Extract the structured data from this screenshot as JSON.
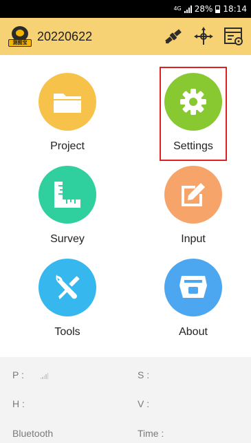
{
  "status_bar": {
    "network": "4G",
    "battery": "28%",
    "time": "18:14"
  },
  "app_bar": {
    "logo_text": "测图宝",
    "project_name": "20220622",
    "actions": [
      {
        "icon": "satellite-icon"
      },
      {
        "icon": "crosshair-icon"
      },
      {
        "icon": "window-settings-icon"
      }
    ]
  },
  "menu": {
    "items": [
      {
        "id": "project",
        "label": "Project",
        "icon": "folder-icon",
        "color": "#f7c24a"
      },
      {
        "id": "settings",
        "label": "Settings",
        "icon": "gear-icon",
        "color": "#88c931"
      },
      {
        "id": "survey",
        "label": "Survey",
        "icon": "ruler-icon",
        "color": "#2fcf9e"
      },
      {
        "id": "input",
        "label": "Input",
        "icon": "edit-icon",
        "color": "#f7a46a"
      },
      {
        "id": "tools",
        "label": "Tools",
        "icon": "wrench-screwdriver-icon",
        "color": "#36b8ef"
      },
      {
        "id": "about",
        "label": "About",
        "icon": "receiver-icon",
        "color": "#4da6f0"
      }
    ],
    "highlighted": "settings"
  },
  "info_panel": {
    "p_label": "P :",
    "s_label": "S :",
    "h_label": "H :",
    "v_label": "V :",
    "bluetooth_label": "Bluetooth",
    "time_label": "Time :"
  }
}
